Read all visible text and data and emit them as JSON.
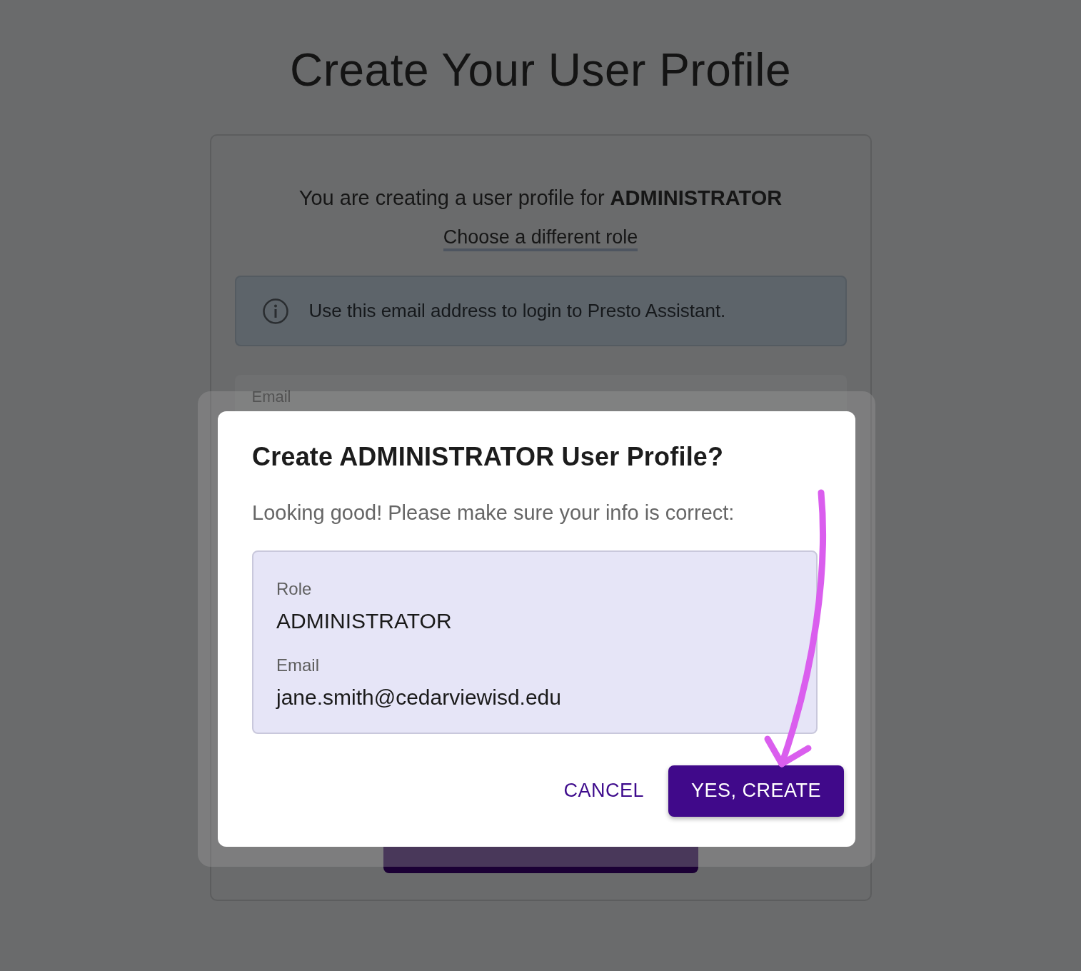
{
  "page": {
    "title": "Create Your User Profile"
  },
  "card": {
    "intro": "You are creating a user profile for **ADMINISTRATOR**",
    "link": "Choose a different role",
    "info": "Use this email address to login to Presto Assistant.",
    "email_label": "Email"
  },
  "dialog": {
    "title": "Create ADMINISTRATOR User Profile?",
    "message": "Looking good! Please make sure your info is correct:",
    "fields": [
      {
        "label": "Role",
        "value": "ADMINISTRATOR"
      },
      {
        "label": "Email",
        "value": "jane.smith@cedarviewisd.edu"
      }
    ],
    "buttons": [
      {
        "label": "CANCEL",
        "kind": "text"
      },
      {
        "label": "YES, CREATE",
        "kind": "contained"
      }
    ]
  }
}
